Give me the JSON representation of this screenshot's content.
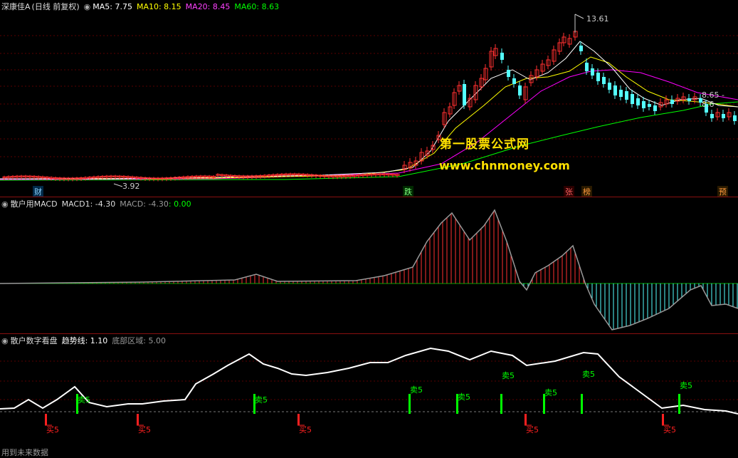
{
  "main_panel": {
    "stock_name": "深康佳A",
    "period": "(日线 前复权)",
    "ma5": "MA5: 7.75",
    "ma10": "MA10: 8.15",
    "ma20": "MA20: 8.45",
    "ma60": "MA60: 8.63",
    "high_label": "13.61",
    "low_label": "3.92",
    "right_label": "8.65 - 8.6",
    "colors": {
      "ma5": "#ffffff",
      "ma10": "#ffff00",
      "ma20": "#ff00ff",
      "ma60": "#00ff00",
      "up": "#ff3030",
      "down": "#54ffff"
    }
  },
  "event_tags": [
    {
      "text": "财",
      "color": "#8fd3ff",
      "bg": "#003050"
    },
    {
      "text": "跌",
      "color": "#7dff7d",
      "bg": "#003300"
    },
    {
      "text": "张",
      "color": "#ff6060",
      "bg": "#300000"
    },
    {
      "text": "榜",
      "color": "#ff9a3c",
      "bg": "#302000"
    },
    {
      "text": "预",
      "color": "#ff9a3c",
      "bg": "#302000"
    }
  ],
  "watermark": {
    "cn": "第一股票公式网",
    "url": "www.chnmoney.com"
  },
  "macd_panel": {
    "title": "散户用MACD",
    "macd1": "MACD1: -4.30",
    "macd": "MACD: -4.30",
    "dif": ": 0.00"
  },
  "digit_panel": {
    "title": "散户数字看盘",
    "trend": "趋势线: 1.10",
    "bottom": "底部区域: 5.00",
    "buy_labels": [
      "买5",
      "买5",
      "买5",
      "买5",
      "买5"
    ],
    "sell_labels": [
      "卖5",
      "卖5",
      "卖5",
      "卖5",
      "卖5",
      "卖5",
      "卖5",
      "卖5",
      "卖5"
    ]
  },
  "footer": "用到未来数据"
}
